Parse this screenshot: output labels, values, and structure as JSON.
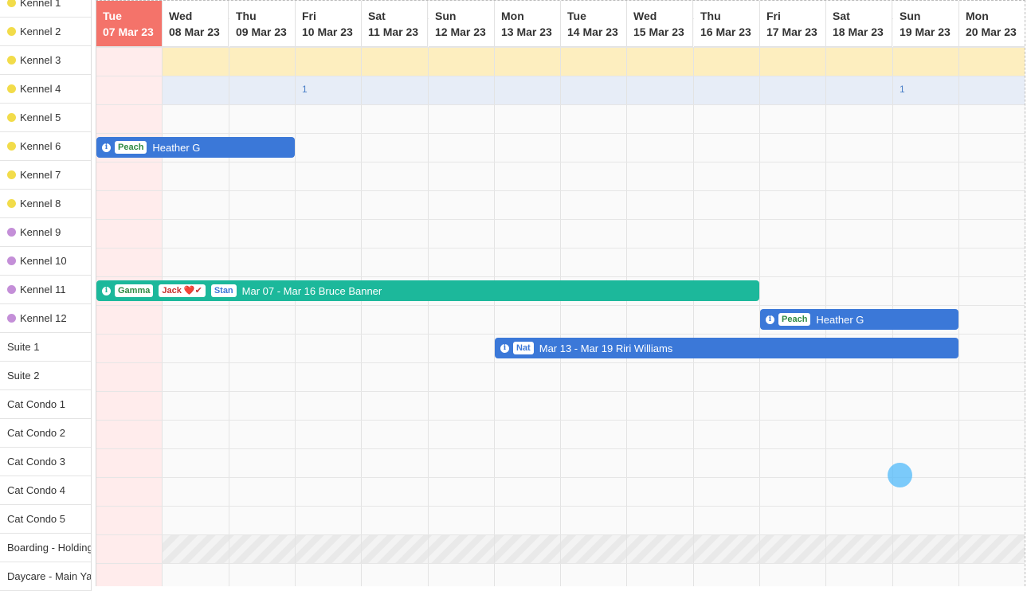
{
  "resources": [
    {
      "name": "Kennel 1",
      "dot": "yellow"
    },
    {
      "name": "Kennel 2",
      "dot": "yellow"
    },
    {
      "name": "Kennel 3",
      "dot": "yellow"
    },
    {
      "name": "Kennel 4",
      "dot": "yellow"
    },
    {
      "name": "Kennel 5",
      "dot": "yellow"
    },
    {
      "name": "Kennel 6",
      "dot": "yellow"
    },
    {
      "name": "Kennel 7",
      "dot": "yellow"
    },
    {
      "name": "Kennel 8",
      "dot": "yellow"
    },
    {
      "name": "Kennel 9",
      "dot": "purple"
    },
    {
      "name": "Kennel 10",
      "dot": "purple"
    },
    {
      "name": "Kennel 11",
      "dot": "purple"
    },
    {
      "name": "Kennel 12",
      "dot": "purple"
    },
    {
      "name": "Suite 1",
      "dot": ""
    },
    {
      "name": "Suite 2",
      "dot": ""
    },
    {
      "name": "Cat Condo 1",
      "dot": ""
    },
    {
      "name": "Cat Condo 2",
      "dot": ""
    },
    {
      "name": "Cat Condo 3",
      "dot": ""
    },
    {
      "name": "Cat Condo 4",
      "dot": ""
    },
    {
      "name": "Cat Condo 5",
      "dot": ""
    },
    {
      "name": "Boarding - Holding",
      "dot": ""
    },
    {
      "name": "Daycare - Main Yard",
      "dot": ""
    }
  ],
  "days": [
    {
      "name": "Tue",
      "date": "07 Mar 23",
      "today": true
    },
    {
      "name": "Wed",
      "date": "08 Mar 23"
    },
    {
      "name": "Thu",
      "date": "09 Mar 23"
    },
    {
      "name": "Fri",
      "date": "10 Mar 23"
    },
    {
      "name": "Sat",
      "date": "11 Mar 23"
    },
    {
      "name": "Sun",
      "date": "12 Mar 23"
    },
    {
      "name": "Mon",
      "date": "13 Mar 23"
    },
    {
      "name": "Tue",
      "date": "14 Mar 23"
    },
    {
      "name": "Wed",
      "date": "15 Mar 23"
    },
    {
      "name": "Thu",
      "date": "16 Mar 23"
    },
    {
      "name": "Fri",
      "date": "17 Mar 23"
    },
    {
      "name": "Sat",
      "date": "18 Mar 23"
    },
    {
      "name": "Sun",
      "date": "19 Mar 23"
    },
    {
      "name": "Mon",
      "date": "20 Mar 23"
    }
  ],
  "counts": [
    {
      "day": "10 Mar 23",
      "value": "1"
    },
    {
      "day": "19 Mar 23",
      "value": "1"
    }
  ],
  "bookings": [
    {
      "resource": "Kennel 5",
      "start_day": "07 Mar 23",
      "end_day": "09 Mar 23",
      "color": "blue",
      "pets": [
        {
          "name": "Peach",
          "tone": "green"
        }
      ],
      "text": "Heather G"
    },
    {
      "resource": "Kennel 10",
      "start_day": "07 Mar 23",
      "end_day": "16 Mar 23",
      "color": "teal",
      "pets": [
        {
          "name": "Gamma",
          "tone": "green"
        },
        {
          "name": "Jack",
          "tone": "red",
          "suffix": "❤️✔"
        },
        {
          "name": "Stan",
          "tone": "blue"
        }
      ],
      "text": "Mar 07 - Mar 16 Bruce Banner"
    },
    {
      "resource": "Kennel 11",
      "start_day": "17 Mar 23",
      "end_day": "19 Mar 23",
      "color": "blue",
      "pets": [
        {
          "name": "Peach",
          "tone": "green"
        }
      ],
      "text": "Heather G"
    },
    {
      "resource": "Kennel 12",
      "start_day": "13 Mar 23",
      "end_day": "19 Mar 23",
      "color": "blue",
      "pets": [
        {
          "name": "Nat",
          "tone": "blue"
        }
      ],
      "text": "Mar 13 - Mar 19 Riri Williams"
    }
  ],
  "colors": {
    "today": "#f4736a",
    "booking_blue": "#3b78d8",
    "booking_teal": "#1cb89b"
  }
}
